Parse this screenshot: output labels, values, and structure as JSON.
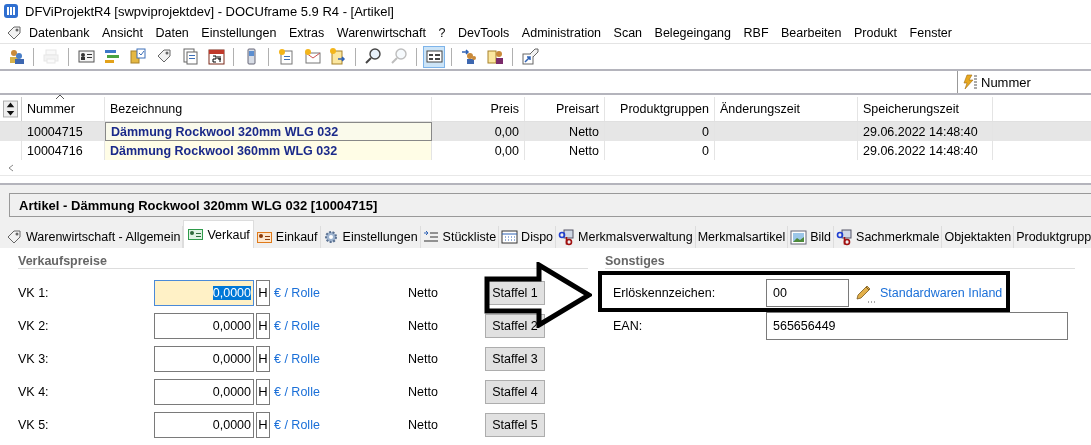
{
  "window": {
    "title": "DFViProjektR4 [swpviprojektdev] - DOCUframe 5.9 R4 - [Artikel]"
  },
  "menu": [
    "Datenbank",
    "Ansicht",
    "Daten",
    "Einstellungen",
    "Extras",
    "Warenwirtschaft",
    "?",
    "DevTools",
    "Administration",
    "Scan",
    "Belegeingang",
    "RBF",
    "Bearbeiten",
    "Produkt",
    "Fenster"
  ],
  "toolbar": [
    {
      "kind": "button",
      "disabled": false,
      "pressed": false
    },
    {
      "kind": "separator"
    },
    {
      "kind": "button",
      "disabled": true,
      "pressed": false
    },
    {
      "kind": "separator"
    },
    {
      "kind": "button",
      "disabled": false,
      "pressed": false
    },
    {
      "kind": "button",
      "disabled": false,
      "pressed": false
    },
    {
      "kind": "button",
      "disabled": false,
      "pressed": false
    },
    {
      "kind": "button",
      "disabled": false,
      "pressed": false
    },
    {
      "kind": "button",
      "disabled": false,
      "pressed": false
    },
    {
      "kind": "button",
      "disabled": false,
      "pressed": false
    },
    {
      "kind": "separator"
    },
    {
      "kind": "button",
      "disabled": false,
      "pressed": false
    },
    {
      "kind": "separator"
    },
    {
      "kind": "button",
      "disabled": false,
      "pressed": false
    },
    {
      "kind": "button",
      "disabled": false,
      "pressed": false
    },
    {
      "kind": "button",
      "disabled": false,
      "pressed": false
    },
    {
      "kind": "separator"
    },
    {
      "kind": "button",
      "disabled": false,
      "pressed": false
    },
    {
      "kind": "button",
      "disabled": true,
      "pressed": false
    },
    {
      "kind": "separator"
    },
    {
      "kind": "button",
      "disabled": false,
      "pressed": true
    },
    {
      "kind": "separator"
    },
    {
      "kind": "button",
      "disabled": false,
      "pressed": false
    },
    {
      "kind": "button",
      "disabled": false,
      "pressed": false
    },
    {
      "kind": "separator"
    },
    {
      "kind": "button",
      "disabled": false,
      "pressed": false
    }
  ],
  "filter": {
    "sort_field": "Nummer"
  },
  "table": {
    "columns": [
      {
        "label": "Nummer",
        "sorted": true
      },
      {
        "label": "Bezeichnung",
        "sorted": false
      },
      {
        "label": "Preis",
        "sorted": false
      },
      {
        "label": "Preisart",
        "sorted": false
      },
      {
        "label": "Produktgruppen",
        "sorted": false
      },
      {
        "label": "Änderungszeit",
        "sorted": false
      },
      {
        "label": "Speicherungszeit",
        "sorted": false
      }
    ],
    "rows": [
      {
        "selected": true,
        "cells": [
          "10004715",
          "Dämmung Rockwool 320mm WLG 032",
          "0,00",
          "Netto",
          "0",
          "",
          "29.06.2022 14:48:40"
        ]
      },
      {
        "selected": false,
        "cells": [
          "10004716",
          "Dämmung Rockwool 360mm WLG 032",
          "0,00",
          "Netto",
          "0",
          "",
          "29.06.2022 14:48:40"
        ]
      }
    ]
  },
  "detail": {
    "title": "Artikel  -  Dämmung Rockwool 320mm WLG 032 [10004715]",
    "tabs": [
      {
        "label": "Warenwirtschaft - Allgemein",
        "selected": false
      },
      {
        "label": "Verkauf",
        "selected": true
      },
      {
        "label": "Einkauf",
        "selected": false
      },
      {
        "label": "Einstellungen",
        "selected": false
      },
      {
        "label": "Stückliste",
        "selected": false
      },
      {
        "label": "Dispo",
        "selected": false
      },
      {
        "label": "Merkmalsverwaltung",
        "selected": false
      },
      {
        "label": "Merkmalsartikel",
        "selected": false
      },
      {
        "label": "Bild",
        "selected": false
      },
      {
        "label": "Sachmerkmale",
        "selected": false
      },
      {
        "label": "Objektakten",
        "selected": false
      },
      {
        "label": "Produktgrupp",
        "selected": false
      }
    ],
    "prices": {
      "title": "Verkaufspreise",
      "rows": [
        {
          "label": "VK 1:",
          "value": "0,0000",
          "focused": true,
          "flag": "H",
          "unit": "€ / Rolle",
          "price_type": "Netto",
          "button": "Staffel 1"
        },
        {
          "label": "VK 2:",
          "value": "0,0000",
          "focused": false,
          "flag": "H",
          "unit": "€ / Rolle",
          "price_type": "Netto",
          "button": "Staffel 2"
        },
        {
          "label": "VK 3:",
          "value": "0,0000",
          "focused": false,
          "flag": "H",
          "unit": "€ / Rolle",
          "price_type": "Netto",
          "button": "Staffel 3"
        },
        {
          "label": "VK 4:",
          "value": "0,0000",
          "focused": false,
          "flag": "H",
          "unit": "€ / Rolle",
          "price_type": "Netto",
          "button": "Staffel 4"
        },
        {
          "label": "VK 5:",
          "value": "0,0000",
          "focused": false,
          "flag": "H",
          "unit": "€ / Rolle",
          "price_type": "Netto",
          "button": "Staffel 5"
        }
      ]
    },
    "other": {
      "title": "Sonstiges",
      "fields": [
        {
          "kind": "lookup",
          "label": "Erlöskennzeichen:",
          "value": "00",
          "link": "Standardwaren Inland"
        },
        {
          "kind": "text",
          "label": "EAN:",
          "value": "565656449"
        }
      ]
    }
  }
}
